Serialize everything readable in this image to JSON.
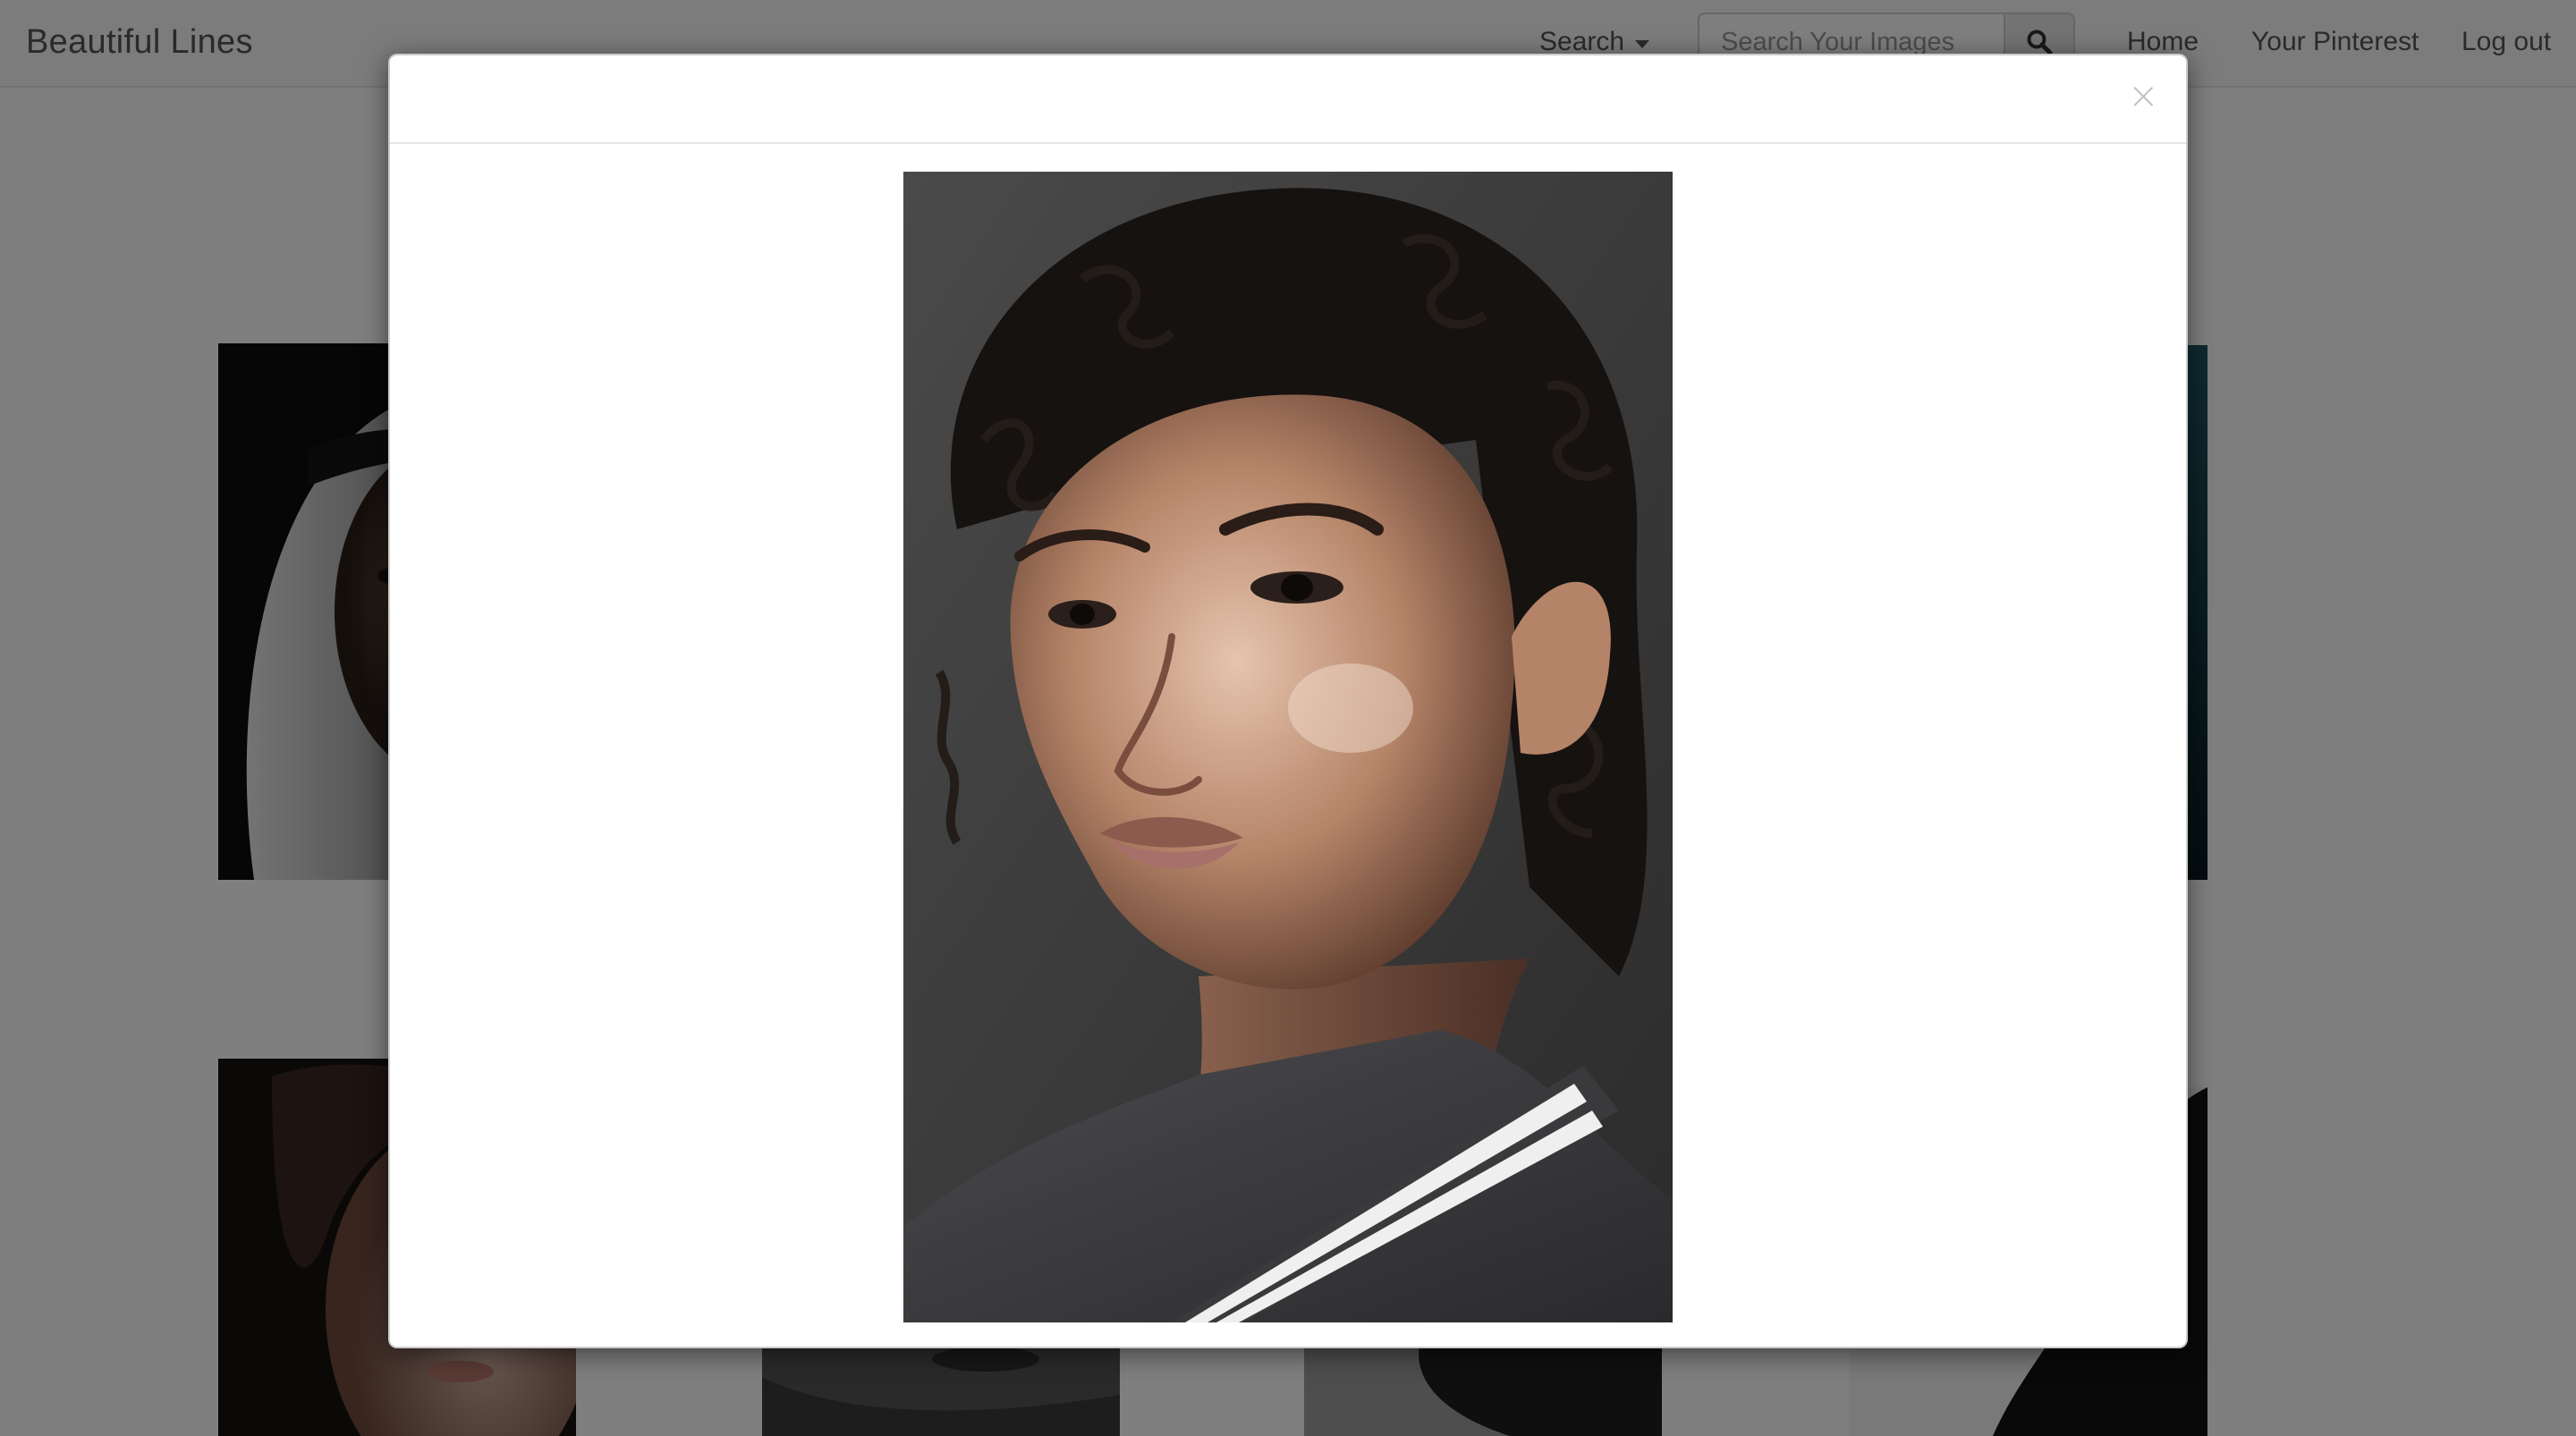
{
  "navbar": {
    "brand": "Beautiful Lines",
    "search_menu_label": "Search",
    "search_placeholder": "Search Your Images",
    "links": {
      "home": "Home",
      "your_pinterest": "Your Pinterest",
      "log_out": "Log out"
    }
  },
  "modal": {
    "close_symbol": "×",
    "photo": "black-and-white portrait of a young woman with curly hair and a striped knit collar"
  },
  "grid": {
    "images": [
      "portrait of a woman wearing a white head scarf",
      "dark teal-toned portrait",
      "portrait of a woman with dark wavy hair",
      "black-and-white portrait close-up of lips and chin",
      "black-and-white profile silhouette",
      "black-and-white portrait with dark hair"
    ]
  },
  "colors": {
    "navbar_bg": "#f8f8f8",
    "backdrop": "rgba(0,0,0,0.5)",
    "modal_bg": "#ffffff",
    "link": "#555555"
  },
  "icons": {
    "search_button": "magnifier-icon",
    "dropdown": "caret-down-icon",
    "close": "close-icon"
  }
}
